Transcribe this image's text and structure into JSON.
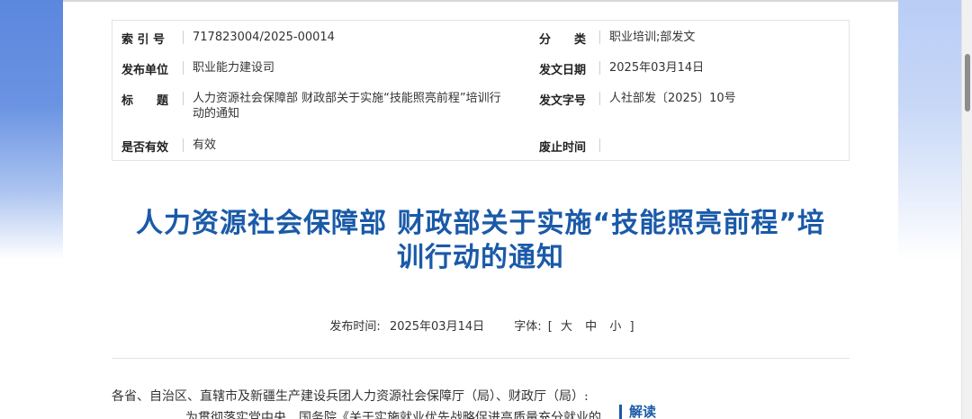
{
  "meta": {
    "index_label": "索 引 号",
    "index_value": "717823004/2025-00014",
    "category_label": "分　　类",
    "category_value": "职业培训;部发文",
    "issuer_label": "发布单位",
    "issuer_value": "职业能力建设司",
    "issue_date_label": "发文日期",
    "issue_date_value": "2025年03月14日",
    "title_label": "标　　题",
    "title_value_line1": "人力资源社会保障部 财政部关于实施“技能照亮前程”培训行",
    "title_value_line2": "动的通知",
    "doc_no_label": "发文字号",
    "doc_no_value": "人社部发〔2025〕10号",
    "valid_label": "是否有效",
    "valid_value": "有效",
    "abolish_label": "废止时间",
    "abolish_value": ""
  },
  "article": {
    "title_line1": "人力资源社会保障部 财政部关于实施“技能照亮前程”培",
    "title_line2": "训行动的通知",
    "publish_label": "发布时间:",
    "publish_date": "2025年03月14日",
    "font_label": "字体:",
    "font_bracket_open": "[",
    "font_large": "大",
    "font_medium": "中",
    "font_small": "小",
    "font_bracket_close": "]",
    "salutation": "各省、自治区、直辖市及新疆生产建设兵团人力资源社会保障厅（局）、财政厅（局）:",
    "body_first_line": "为贯彻落实党中央、国务院《关于实施就业优先战略促进高质量充分就业的意",
    "interpretation_label": "解读"
  },
  "colors": {
    "title_blue": "#1a5aa8",
    "left_band": "#5b87de",
    "right_band": "#b9cdf5"
  }
}
